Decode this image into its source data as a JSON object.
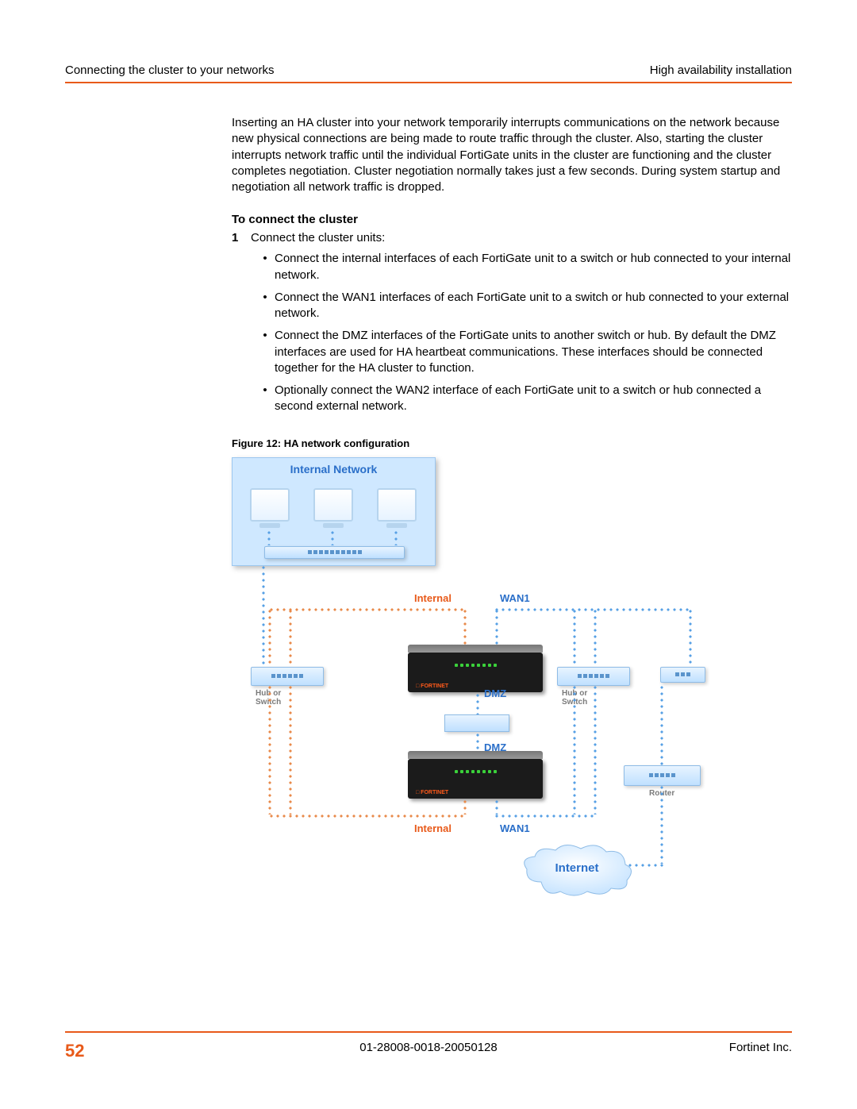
{
  "header": {
    "left": "Connecting the cluster to your networks",
    "right": "High availability installation"
  },
  "intro": "Inserting an HA cluster into your network temporarily interrupts communications on the network because new physical connections are being made to route traffic through the cluster. Also, starting the cluster interrupts network traffic until the individual FortiGate units in the cluster are functioning and the cluster completes negotiation. Cluster negotiation normally takes just a few seconds. During system startup and negotiation all network traffic is dropped.",
  "subhead": "To connect the cluster",
  "step1_num": "1",
  "step1_text": "Connect the cluster units:",
  "bullets": [
    "Connect the internal interfaces of each FortiGate unit to a switch or hub connected to your internal network.",
    "Connect the WAN1 interfaces of each FortiGate unit to a switch or hub connected to your external network.",
    "Connect the DMZ interfaces of the FortiGate units to another switch or hub. By default the DMZ interfaces are used for HA heartbeat communications. These interfaces should be connected together for the HA cluster to function.",
    "Optionally connect the WAN2 interface of each FortiGate unit to a switch or hub connected a second external network."
  ],
  "figcap": "Figure 12: HA network configuration",
  "diagram": {
    "internal_network": "Internal Network",
    "internal": "Internal",
    "wan1": "WAN1",
    "dmz": "DMZ",
    "hub_or_switch": "Hub or\nSwitch",
    "router": "Router",
    "internet": "Internet"
  },
  "footer": {
    "page": "52",
    "docnum": "01-28008-0018-20050128",
    "company": "Fortinet Inc."
  }
}
